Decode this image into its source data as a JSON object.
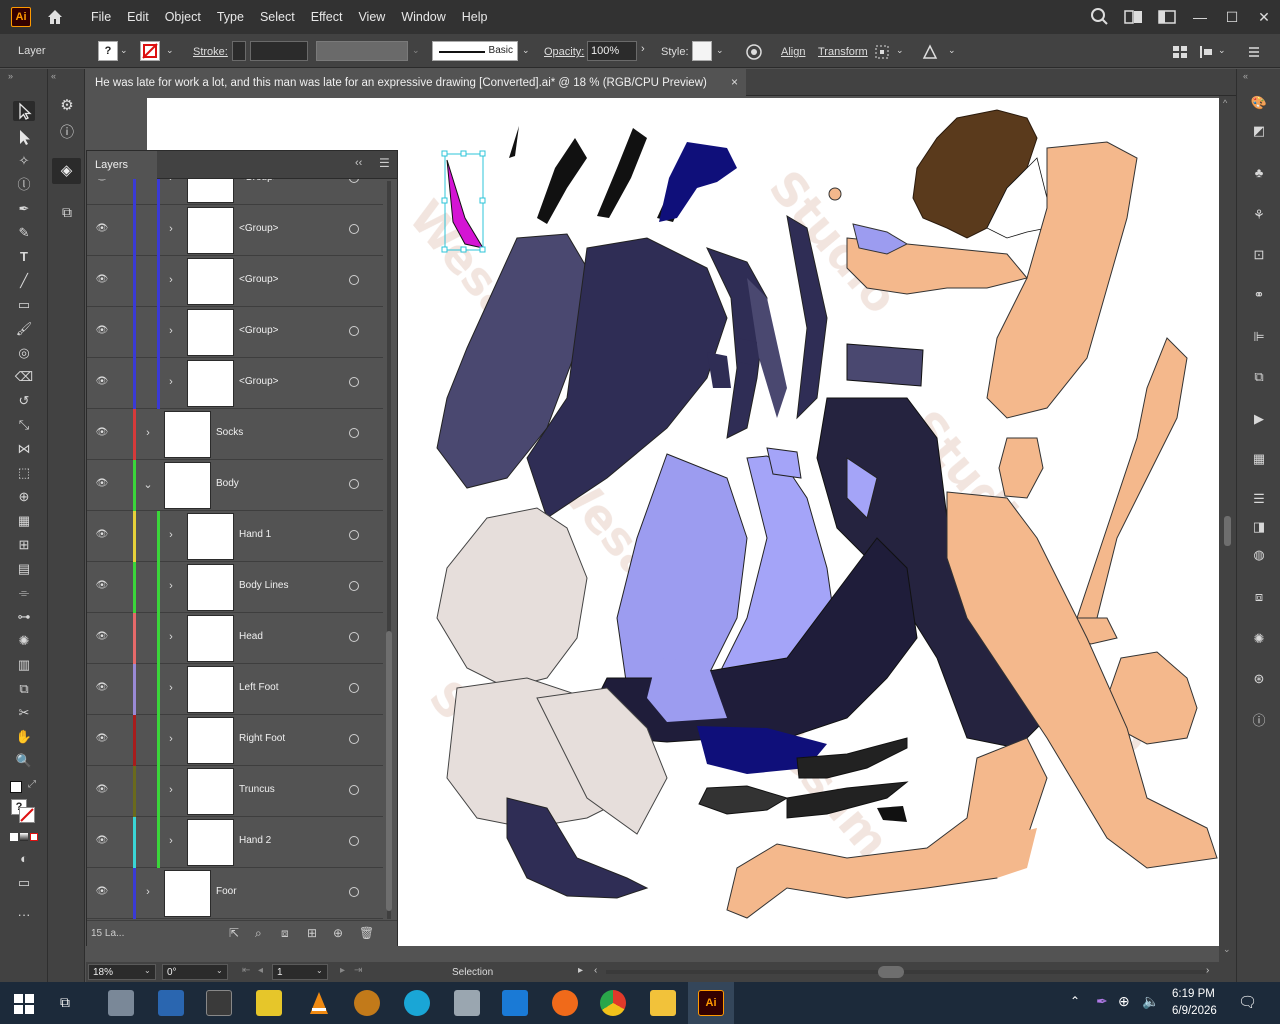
{
  "app": {
    "logo": "Ai"
  },
  "menu": {
    "items": [
      "File",
      "Edit",
      "Object",
      "Type",
      "Select",
      "Effect",
      "View",
      "Window",
      "Help"
    ]
  },
  "control_bar": {
    "selection_label": "Layer",
    "stroke_label": "Stroke:",
    "brush_label": "Basic",
    "opacity_label": "Opacity:",
    "opacity_value": "100%",
    "style_label": "Style:",
    "align_label": "Align",
    "transform_label": "Transform"
  },
  "document": {
    "tab_title": "He was late for work a lot, and this man was late for an expressive drawing [Converted].ai* @ 18 % (RGB/CPU Preview)",
    "close": "×"
  },
  "layers_panel": {
    "title": "Layers",
    "rows": [
      {
        "name": "<Group>",
        "color": "#3a3ad6",
        "indent": 2
      },
      {
        "name": "<Group>",
        "color": "#3a3ad6",
        "indent": 2
      },
      {
        "name": "<Group>",
        "color": "#3a3ad6",
        "indent": 2
      },
      {
        "name": "<Group>",
        "color": "#3a3ad6",
        "indent": 2
      },
      {
        "name": "<Group>",
        "color": "#3a3ad6",
        "indent": 2
      },
      {
        "name": "Socks",
        "color": "#d63a3a",
        "indent": 1
      },
      {
        "name": "Body",
        "color": "#3ad63a",
        "indent": 1
      },
      {
        "name": "Hand 1",
        "color": "#e6d23a",
        "indent": 2
      },
      {
        "name": "Body Lines",
        "color": "#3ad63a",
        "indent": 2
      },
      {
        "name": "Head",
        "color": "#e66a6a",
        "indent": 2
      },
      {
        "name": "Left Foot",
        "color": "#9a8ad6",
        "indent": 2
      },
      {
        "name": "Right Foot",
        "color": "#a81c1c",
        "indent": 2
      },
      {
        "name": "Truncus",
        "color": "#6a6a1c",
        "indent": 2
      },
      {
        "name": "Hand 2",
        "color": "#3ad6d6",
        "indent": 2
      },
      {
        "name": "Foor",
        "color": "#3a3ad6",
        "indent": 1
      }
    ],
    "footer_count": "15 La..."
  },
  "status_bar": {
    "zoom": "18%",
    "rotation": "0°",
    "artboard": "1",
    "tool_status": "Selection"
  },
  "taskbar": {
    "time": "6:19 PM",
    "date": "6/9/2026"
  },
  "colors": {
    "navy": "#2f2d55",
    "lavender": "#9c9cf0",
    "skin": "#f4b88c",
    "dark_navy": "#0f0f7a",
    "gray_cloth": "#e6dedb",
    "magenta": "#d414d4"
  }
}
